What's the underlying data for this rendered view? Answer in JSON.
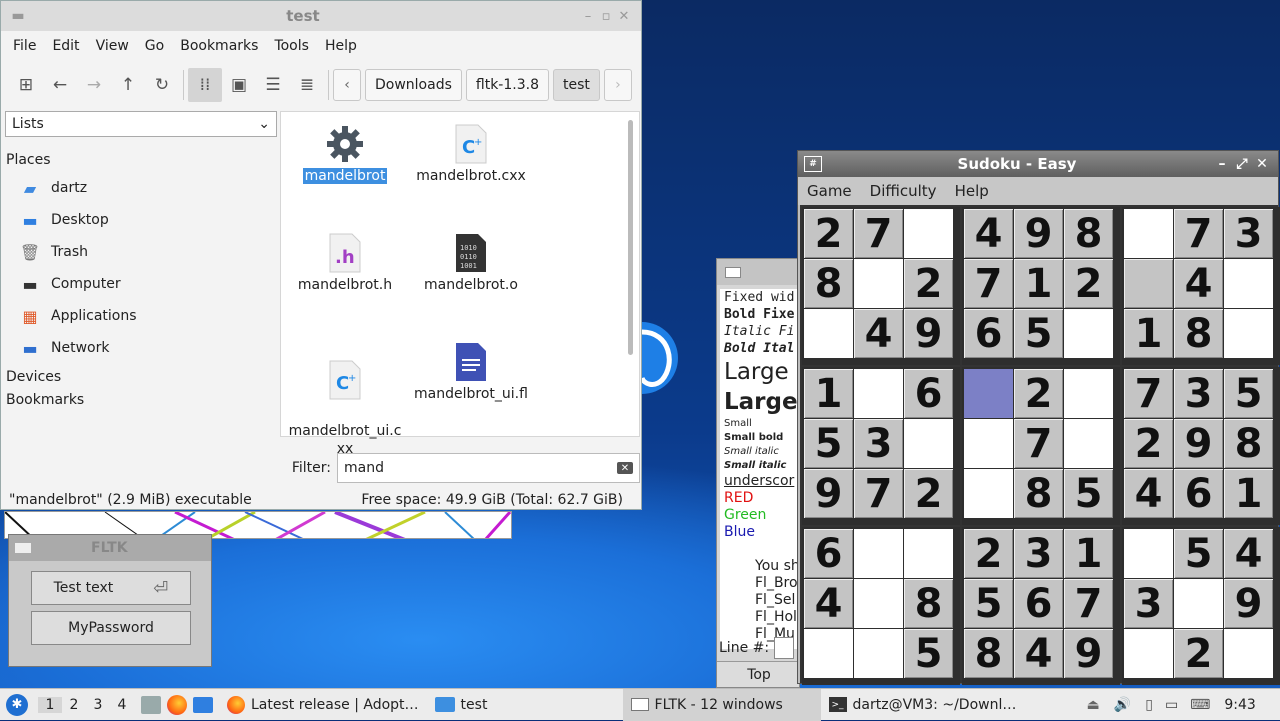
{
  "file_manager": {
    "title": "test",
    "menu": [
      "File",
      "Edit",
      "View",
      "Go",
      "Bookmarks",
      "Tools",
      "Help"
    ],
    "breadcrumbs": [
      "Downloads",
      "fltk-1.3.8",
      "test"
    ],
    "side_select": "Lists",
    "places_header": "Places",
    "places": [
      {
        "label": "dartz",
        "icon": "home-folder-icon"
      },
      {
        "label": "Desktop",
        "icon": "desktop-icon"
      },
      {
        "label": "Trash",
        "icon": "trash-icon"
      },
      {
        "label": "Computer",
        "icon": "computer-icon"
      },
      {
        "label": "Applications",
        "icon": "applications-icon"
      },
      {
        "label": "Network",
        "icon": "network-icon"
      }
    ],
    "devices_header": "Devices",
    "bookmarks_header": "Bookmarks",
    "files": [
      {
        "name": "mandelbrot",
        "icon": "executable-gear-icon",
        "selected": true
      },
      {
        "name": "mandelbrot.cxx",
        "icon": "cpp-source-icon"
      },
      {
        "name": "mandelbrot.h",
        "icon": "c-header-icon"
      },
      {
        "name": "mandelbrot.o",
        "icon": "object-file-icon"
      },
      {
        "name": "mandelbrot_ui.c\nxx",
        "icon": "cpp-source-icon"
      },
      {
        "name": "mandelbrot_ui.fl",
        "icon": "text-document-icon"
      }
    ],
    "filter_label": "Filter:",
    "filter_value": "mand",
    "status_left": "\"mandelbrot\" (2.9 MiB) executable",
    "status_right": "Free space: 49.9 GiB (Total: 62.7 GiB)"
  },
  "fltk_window": {
    "title": "FLTK",
    "buttons": [
      "Test text",
      "MyPassword"
    ]
  },
  "text_window": {
    "lines": [
      "Fixed wid",
      "Bold Fixe",
      "Italic Fi",
      "Bold Ital",
      "Large",
      "Large",
      "Small",
      "Small bold",
      "Small italic",
      "Small italic",
      "underscor",
      "RED",
      "Green",
      "Blue",
      "",
      "You sh",
      "Fl_Bro",
      "Fl_Sel",
      "Fl_Hol",
      "Fl_Mu"
    ],
    "line_label": "Line #:",
    "top_button": "Top",
    "colors": {
      "red": "#e11111",
      "green": "#22bb22",
      "blue": "#1a1ab0"
    }
  },
  "sudoku": {
    "title": "Sudoku - Easy",
    "menu": [
      "Game",
      "Difficulty",
      "Help"
    ],
    "grid": [
      [
        "2",
        "7",
        "",
        "4",
        "9",
        "8",
        "",
        "7",
        "3"
      ],
      [
        "8",
        "",
        "2",
        "7",
        "1",
        "2",
        "",
        "4",
        ""
      ],
      [
        "",
        "4",
        "9",
        "6",
        "5",
        "",
        "1",
        "8",
        ""
      ],
      [
        "1",
        "",
        "6",
        "",
        "2",
        "",
        "7",
        "3",
        "5"
      ],
      [
        "5",
        "3",
        "",
        "",
        "7",
        "",
        "2",
        "9",
        "8"
      ],
      [
        "9",
        "7",
        "2",
        "",
        "8",
        "5",
        "4",
        "6",
        "1"
      ],
      [
        "6",
        "",
        "",
        "2",
        "3",
        "1",
        "",
        "5",
        "4"
      ],
      [
        "4",
        "",
        "8",
        "5",
        "6",
        "7",
        "3",
        "",
        "9"
      ],
      [
        "",
        "",
        "5",
        "8",
        "4",
        "9",
        "",
        "2",
        ""
      ]
    ],
    "white_cells": [
      "0-2",
      "0-6",
      "1-1",
      "1-8",
      "2-0",
      "2-5",
      "2-8",
      "3-1",
      "3-5",
      "4-2",
      "4-3",
      "4-5",
      "5-3",
      "6-1",
      "6-2",
      "6-6",
      "7-1",
      "7-7",
      "8-0",
      "8-1",
      "8-6",
      "8-8"
    ],
    "selected_cell": "3-3",
    "selected_color": "#7c80c6"
  },
  "taskbar": {
    "workspaces": [
      "1",
      "2",
      "3",
      "4"
    ],
    "tasks": [
      {
        "label": "Latest release | Adopt…",
        "icon": "firefox-icon"
      },
      {
        "label": "test",
        "icon": "folder-icon"
      },
      {
        "label": "FLTK - 12 windows",
        "icon": "window-icon",
        "active": true
      },
      {
        "label": "dartz@VM3: ~/Downl…",
        "icon": "terminal-icon"
      }
    ],
    "clock": "9:43"
  }
}
